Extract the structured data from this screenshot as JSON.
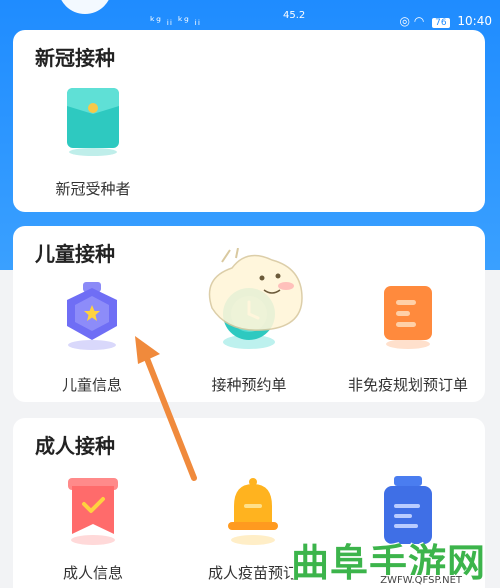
{
  "status_bar": {
    "signal": "ᵏᵍ ᵢᵢ ᵏᵍ ᵢᵢ",
    "speed": "45.2",
    "battery": "76",
    "time": "10:40"
  },
  "sections": {
    "covid": {
      "title": "新冠接种",
      "items": [
        {
          "label": "新冠受种者",
          "icon": "envelope-icon"
        }
      ]
    },
    "child": {
      "title": "儿童接种",
      "items": [
        {
          "label": "儿童信息",
          "icon": "badge-star-icon"
        },
        {
          "label": "接种预约单",
          "icon": "clock-icon"
        },
        {
          "label": "非免疫规划预订单",
          "icon": "document-icon"
        }
      ]
    },
    "adult": {
      "title": "成人接种",
      "items": [
        {
          "label": "成人信息",
          "icon": "ribbon-check-icon"
        },
        {
          "label": "成人疫苗预订",
          "icon": "bell-icon"
        },
        {
          "label": "",
          "icon": "vaccine-bottle-icon"
        }
      ]
    }
  },
  "watermark": {
    "text": "曲阜手游网",
    "url": "ZWFW.QFSP.NET"
  },
  "colors": {
    "header_blue": "#1f8cff",
    "teal": "#2ec9c0",
    "purple": "#6f6ef5",
    "orange": "#ff8a3d",
    "red": "#ff6b6b",
    "yellow": "#ffb31f",
    "arrow": "#f08a3c"
  }
}
